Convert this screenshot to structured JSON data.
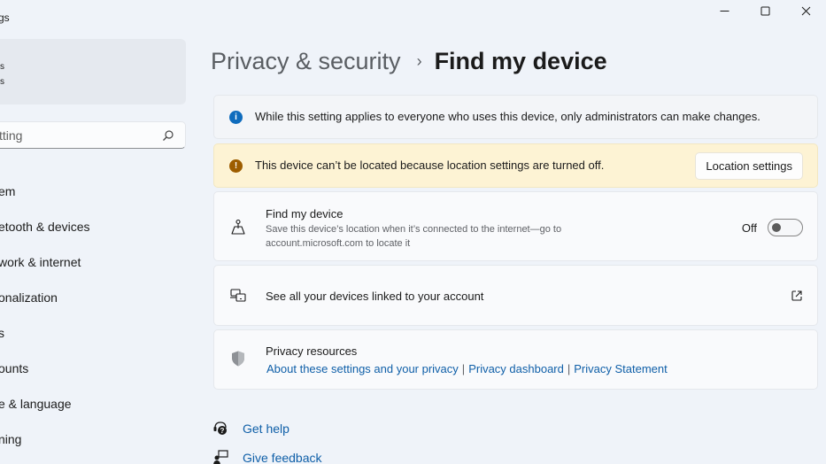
{
  "window": {
    "title_fragment": "gs",
    "controls": {
      "minimize": "minimize",
      "maximize": "maximize",
      "close": "close"
    }
  },
  "sidebar": {
    "profile": {
      "line1": "s",
      "line2": "s"
    },
    "search": {
      "value": "tting",
      "icon": "search-icon"
    },
    "items": [
      {
        "label": "em"
      },
      {
        "label": "etooth & devices"
      },
      {
        "label": "work & internet"
      },
      {
        "label": "onalization"
      },
      {
        "label": "s"
      },
      {
        "label": "ounts"
      },
      {
        "label": "e & language"
      },
      {
        "label": "ning"
      }
    ]
  },
  "breadcrumb": {
    "parent": "Privacy & security",
    "separator": "›",
    "current": "Find my device"
  },
  "info_banner": {
    "icon": "info-icon",
    "text": "While this setting applies to everyone who uses this device, only administrators can make changes."
  },
  "warning_banner": {
    "icon": "warning-icon",
    "text": "This device can’t be located because location settings are turned off.",
    "button_label": "Location settings"
  },
  "find_my_device": {
    "title": "Find my device",
    "description": "Save this device’s location when it’s connected to the internet—go to account.microsoft.com to locate it",
    "toggle_label": "Off",
    "toggle_on": false
  },
  "devices_link": {
    "title": "See all your devices linked to your account"
  },
  "privacy_resources": {
    "title": "Privacy resources",
    "links": [
      "About these settings and your privacy",
      "Privacy dashboard",
      "Privacy Statement"
    ],
    "separator": "|"
  },
  "help": {
    "get_help": "Get help",
    "give_feedback": "Give feedback"
  },
  "colors": {
    "accent": "#0f6cbd",
    "link": "#0f5fa8",
    "warning_bg": "#fdf3d4",
    "warning_icon": "#9d5d00",
    "background": "#eff3f9"
  }
}
